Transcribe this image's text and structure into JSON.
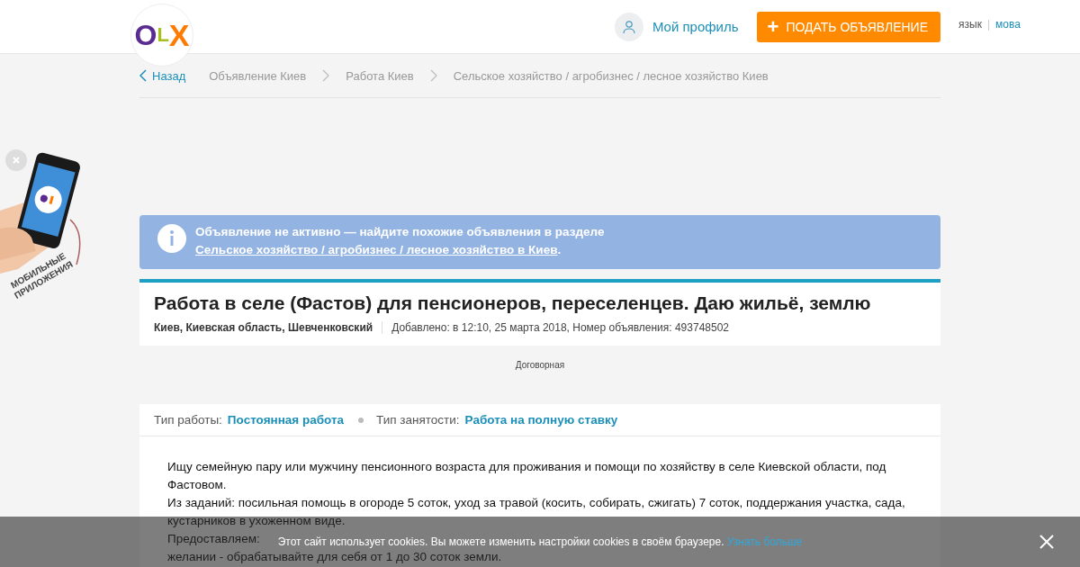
{
  "header": {
    "logo": {
      "letters": [
        "O",
        "L",
        "X"
      ]
    },
    "profile": "Мой профиль",
    "post_button": {
      "icon": "+",
      "label": "ПОДАТЬ ОБЪЯВЛЕНИЕ"
    },
    "language_separator": "|",
    "languages": [
      {
        "label": "язык",
        "selected": true
      },
      {
        "label": "мова",
        "selected": false
      }
    ]
  },
  "breadcrumbs": {
    "back": "Назад",
    "items": [
      "Объявление Киев",
      "Работа Киев",
      "Сельское хозяйство / агробизнес / лесное хозяйство Киев"
    ]
  },
  "promo": {
    "caption": [
      "МОБИЛЬНЫЕ",
      "ПРИЛОЖЕНИЯ"
    ]
  },
  "notice": {
    "text": "Объявление не активно — найдите похожие объявления в разделе ",
    "link": "Сельское хозяйство / агробизнес / лесное хозяйство в Киев",
    "end": "."
  },
  "ad": {
    "title": "Работа в селе (Фастов) для пенсионеров, переселенцев. Даю жильё, землю",
    "location": "Киев, Киевская область, Шевченковский",
    "added": "Добавлено: в 12:10, 25 марта 2018, Номер объявления: 493748502",
    "price": "Договорная",
    "params": [
      {
        "label": "Тип работы:",
        "value": "Постоянная работа"
      },
      {
        "label": "Тип занятости:",
        "value": "Работа на полную ставку"
      }
    ],
    "description": [
      "Ищу семейную пару или мужчину пенсионного возраста для проживания и помощи по хозяйству в селе Киевской области, под Фастовом.",
      "Из заданий: посильная помощь в огороде 5 соток, уход за травой (косить, собирать, сжигать) 7 соток, поддержания участка, сада, кустарников в ухоженном виде."
    ],
    "description_partial": {
      "start": "Предоставляем:",
      "next": "желании - обрабатывайте для себя от 1 до 30 соток земли."
    }
  },
  "cookie_bar": {
    "text": "Этот сайт использует cookies. Вы можете изменить настройки cookies в своём браузере. ",
    "link": "Узнать больше"
  }
}
